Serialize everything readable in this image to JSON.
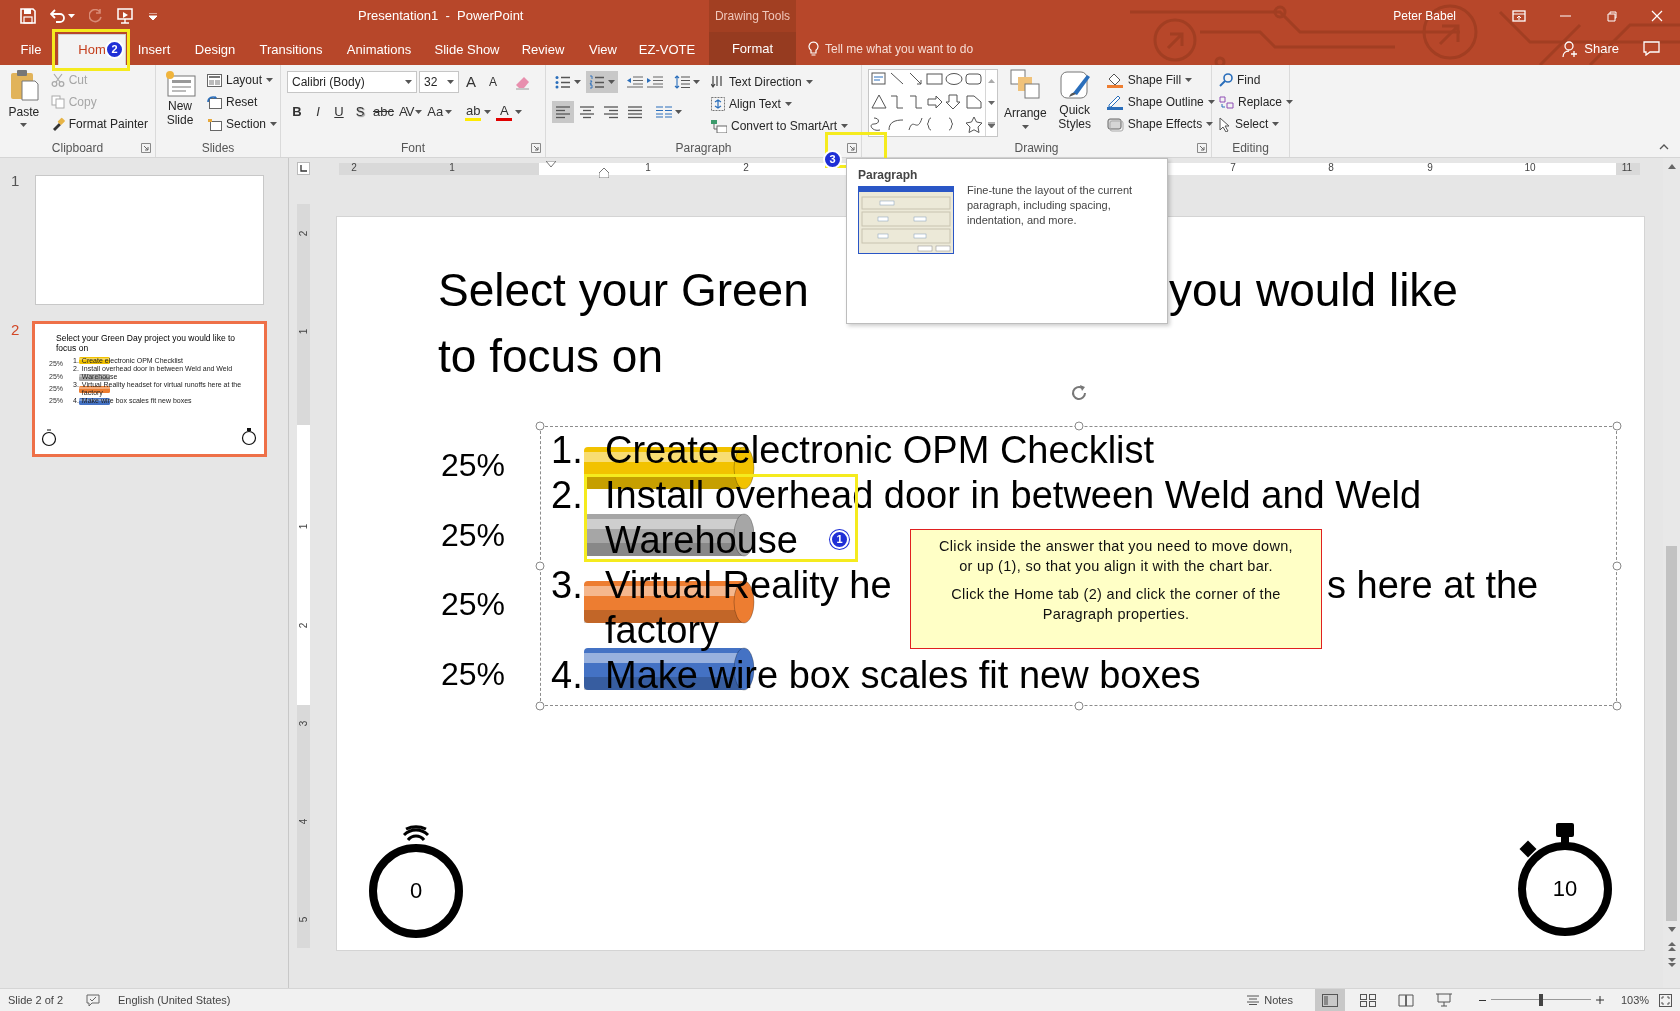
{
  "title_bar": {
    "title": "Presentation1  -  PowerPoint",
    "context_label": "Drawing Tools",
    "user": "Peter Babel"
  },
  "tabs": [
    {
      "label": "File",
      "kind": "file",
      "selected": false
    },
    {
      "label": "Hom",
      "kind": "tab",
      "selected": true,
      "badge": "2"
    },
    {
      "label": "Insert",
      "kind": "tab",
      "selected": false
    },
    {
      "label": "Design",
      "kind": "tab",
      "selected": false
    },
    {
      "label": "Transitions",
      "kind": "tab",
      "selected": false
    },
    {
      "label": "Animations",
      "kind": "tab",
      "selected": false
    },
    {
      "label": "Slide Show",
      "kind": "tab",
      "selected": false
    },
    {
      "label": "Review",
      "kind": "tab",
      "selected": false
    },
    {
      "label": "View",
      "kind": "tab",
      "selected": false
    },
    {
      "label": "EZ-VOTE",
      "kind": "tab",
      "selected": false
    },
    {
      "label": "Format",
      "kind": "contextual",
      "selected": false
    }
  ],
  "tell_me": {
    "placeholder": "Tell me what you want to do"
  },
  "share": "Share",
  "ribbon": {
    "clipboard": {
      "label": "Clipboard",
      "paste": "Paste",
      "commands": [
        {
          "label": "Cut",
          "disabled": true
        },
        {
          "label": "Copy",
          "disabled": true
        },
        {
          "label": "Format Painter",
          "disabled": false
        }
      ]
    },
    "slides": {
      "label": "Slides",
      "new_slide": "New Slide",
      "commands": [
        "Layout",
        "Reset",
        "Section"
      ]
    },
    "font": {
      "label": "Font",
      "font_name": "Calibri (Body)",
      "font_size": "32",
      "size_buttons": [
        "A",
        "A"
      ],
      "format_buttons": [
        "B",
        "I",
        "U",
        "S",
        "abc",
        "AV",
        "Aa"
      ],
      "color_buttons": [
        "ab",
        "A"
      ]
    },
    "paragraph": {
      "label": "Paragraph",
      "launcher_badge": "3",
      "list_buttons": [
        {
          "kind": "bullets",
          "selected": false
        },
        {
          "kind": "numbering",
          "selected": true
        }
      ],
      "align_buttons": [
        {
          "kind": "left",
          "selected": true
        },
        {
          "kind": "center",
          "selected": false
        },
        {
          "kind": "right",
          "selected": false
        },
        {
          "kind": "justify",
          "selected": false
        }
      ],
      "commands": [
        "Text Direction",
        "Align Text",
        "Convert to SmartArt"
      ]
    },
    "drawing": {
      "label": "Drawing",
      "arrange": "Arrange",
      "quick_styles": "Quick Styles",
      "commands": [
        "Shape Fill",
        "Shape Outline",
        "Shape Effects"
      ]
    },
    "editing": {
      "label": "Editing",
      "commands": [
        "Find",
        "Replace",
        "Select"
      ]
    }
  },
  "screentip": {
    "title": "Paragraph",
    "description": "Fine-tune the layout of the current paragraph, including spacing, indentation, and more."
  },
  "horizontal_ruler": [
    "2",
    "1",
    "1",
    "2",
    "7",
    "8",
    "9",
    "10",
    "11"
  ],
  "vertical_ruler": [
    "2",
    "1",
    "1",
    "2",
    "3",
    "4",
    "5"
  ],
  "thumbnails": [
    {
      "number": "1",
      "selected": false
    },
    {
      "number": "2",
      "selected": true,
      "title": "Select your Green Day project you would like to focus on",
      "percent_labels": [
        "25%",
        "25%",
        "25%",
        "25%"
      ],
      "answers": [
        {
          "number": "1.",
          "text": "Create electronic OPM Checklist",
          "color": "#f2c200"
        },
        {
          "number": "2.",
          "text": "Install overhead door in between Weld and Weld Warehouse",
          "color": "#a6a6a6"
        },
        {
          "number": "3.",
          "text": "Virtual Reality headset for virtual runoffs here at the factory",
          "color": "#ed7d31"
        },
        {
          "number": "4.",
          "text": "Make wire box scales fit new boxes",
          "color": "#4472c4"
        }
      ]
    }
  ],
  "slide": {
    "title_lines": [
      [
        "Select your Green",
        "you would like"
      ],
      [
        "to focus on"
      ]
    ],
    "percent_labels": [
      "25%",
      "25%",
      "25%",
      "25%"
    ],
    "answers": [
      {
        "number": "1.",
        "color": "#f2c200",
        "highlighted": false,
        "lines": [
          [
            "Create electronic OPM Checklist"
          ]
        ]
      },
      {
        "number": "2.",
        "color": "#a6a6a6",
        "highlighted": true,
        "badge": "1",
        "lines": [
          [
            "Install overhead door in between Weld and Weld"
          ],
          [
            "Warehouse"
          ]
        ]
      },
      {
        "number": "3.",
        "color": "#ed7d31",
        "highlighted": false,
        "lines": [
          [
            "Virtual Reality he",
            "s here at the"
          ],
          [
            "factory"
          ]
        ]
      },
      {
        "number": "4.",
        "color": "#4472c4",
        "highlighted": false,
        "lines": [
          [
            "Make wire box scales fit new boxes"
          ]
        ]
      }
    ],
    "callout": {
      "paragraphs": [
        "Click inside the answer that you need to move down, or up (1), so that you align it with the chart bar.",
        "Click the Home tab (2) and click the corner of the Paragraph properties."
      ]
    },
    "timers": [
      {
        "label": "0",
        "kind": "signal"
      },
      {
        "label": "10",
        "kind": "stopwatch"
      }
    ]
  },
  "status_bar": {
    "slide_info": "Slide 2 of 2",
    "language": "English (United States)",
    "notes": "Notes",
    "views": [
      {
        "kind": "normal",
        "selected": true
      },
      {
        "kind": "sorter",
        "selected": false
      },
      {
        "kind": "reading",
        "selected": false
      },
      {
        "kind": "slideshow",
        "selected": false
      }
    ],
    "zoom": {
      "level": 0.5,
      "reading": "103%"
    }
  }
}
